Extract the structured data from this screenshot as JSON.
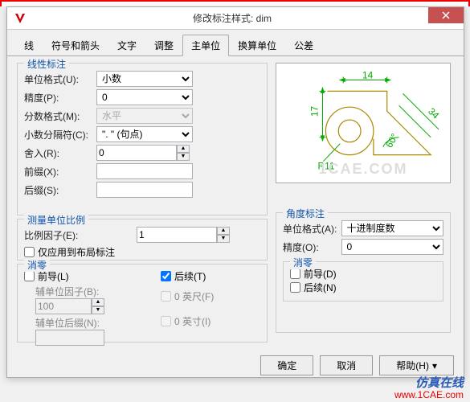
{
  "window": {
    "title": "修改标注样式: dim"
  },
  "tabs": {
    "items": [
      "线",
      "符号和箭头",
      "文字",
      "调整",
      "主单位",
      "换算单位",
      "公差"
    ],
    "active_index": 4
  },
  "linear": {
    "group_title": "线性标注",
    "unit_format_label": "单位格式(U):",
    "unit_format_value": "小数",
    "precision_label": "精度(P):",
    "precision_value": "0",
    "fraction_format_label": "分数格式(M):",
    "fraction_format_value": "水平",
    "decimal_sep_label": "小数分隔符(C):",
    "decimal_sep_value": "\". \"  (句点)",
    "roundoff_label": "舍入(R):",
    "roundoff_value": "0",
    "prefix_label": "前缀(X):",
    "prefix_value": "",
    "suffix_label": "后缀(S):",
    "suffix_value": ""
  },
  "scale": {
    "group_title": "测量单位比例",
    "factor_label": "比例因子(E):",
    "factor_value": "1",
    "layout_only_label": "仅应用到布局标注"
  },
  "zero": {
    "group_title": "消零",
    "leading_label": "前导(L)",
    "trailing_label": "后续(T)",
    "trailing_checked": true,
    "sub_factor_label": "辅单位因子(B):",
    "sub_factor_value": "100",
    "feet_label": "0 英尺(F)",
    "sub_suffix_label": "辅单位后缀(N):",
    "sub_suffix_value": "",
    "inches_label": "0 英寸(I)"
  },
  "angular": {
    "group_title": "角度标注",
    "unit_format_label": "单位格式(A):",
    "unit_format_value": "十进制度数",
    "precision_label": "精度(O):",
    "precision_value": "0",
    "zero_title": "消零",
    "leading_label": "前导(D)",
    "trailing_label": "后续(N)"
  },
  "preview": {
    "dim1": "14",
    "dim2": "17",
    "dim3": "34",
    "angle": "60°",
    "radius": "R11"
  },
  "buttons": {
    "ok": "确定",
    "cancel": "取消",
    "help": "帮助(H)"
  },
  "watermark": {
    "line1": "仿真在线",
    "line2": "www.1CAE.com",
    "preview": "1CAE.COM"
  }
}
